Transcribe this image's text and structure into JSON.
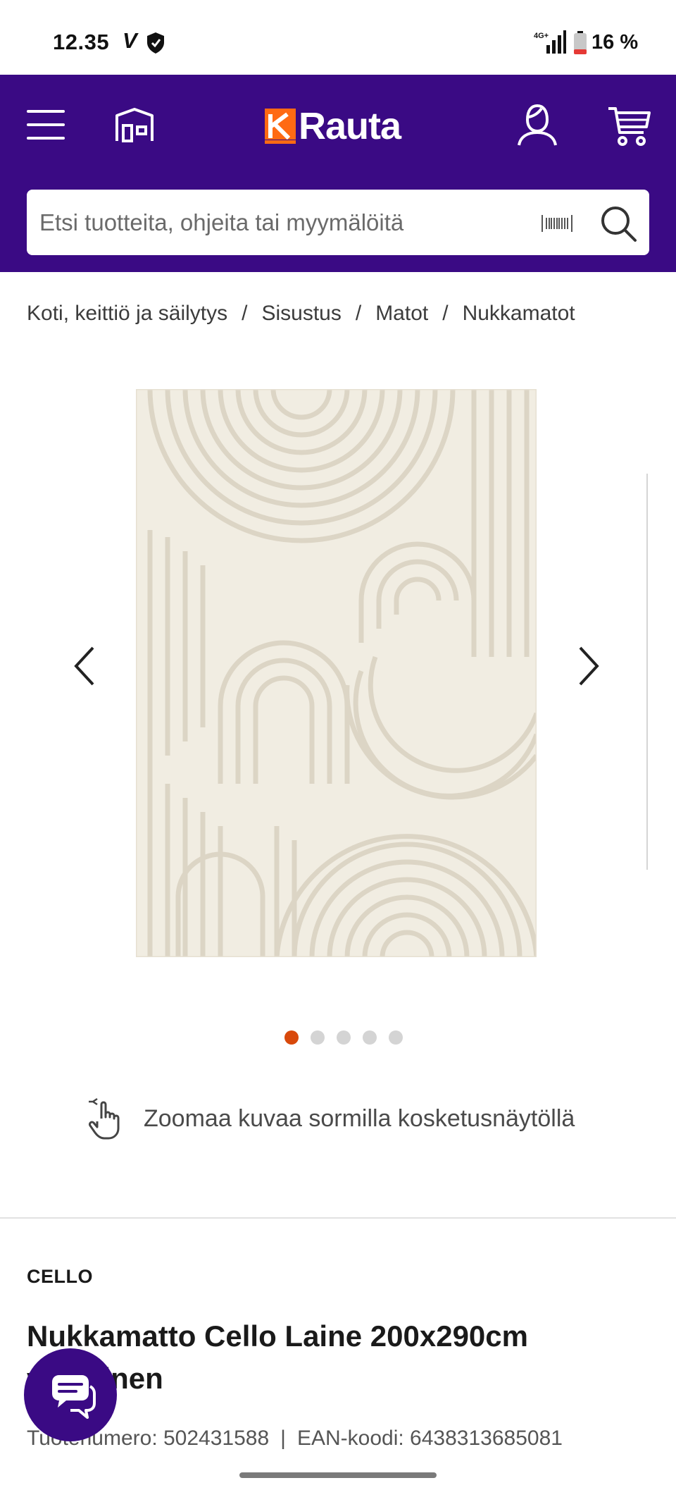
{
  "status_bar": {
    "time": "12.35",
    "carrier_mark": "V",
    "network": "4G+",
    "battery": "16 %"
  },
  "header": {
    "logo_letter": "K",
    "logo_text": "Rauta",
    "colors": {
      "background": "#3a0a84",
      "logo_accent": "#ff6a13"
    },
    "icons": [
      "menu-icon",
      "store-icon",
      "user-icon",
      "cart-icon"
    ]
  },
  "search": {
    "placeholder": "Etsi tuotteita, ohjeita tai myymälöitä",
    "icons": [
      "barcode-scan-icon",
      "search-icon"
    ]
  },
  "breadcrumb": {
    "items": [
      "Koti, keittiö ja säilytys",
      "Sisustus",
      "Matot",
      "Nukkamatot"
    ],
    "separator": "/"
  },
  "gallery": {
    "image_count": 5,
    "active_index": 1,
    "colors": {
      "active_dot": "#d8490b",
      "inactive_dot": "#d4d4d4"
    }
  },
  "zoom_hint": "Zoomaa kuvaa sormilla kosketusnäytöllä",
  "product": {
    "brand": "CELLO",
    "title": "Nukkamatto Cello Laine 200x290cm valkoinen",
    "product_number_label": "Tuotenumero:",
    "product_number": "502431588",
    "ean_label": "EAN-koodi:",
    "ean": "6438313685081"
  }
}
